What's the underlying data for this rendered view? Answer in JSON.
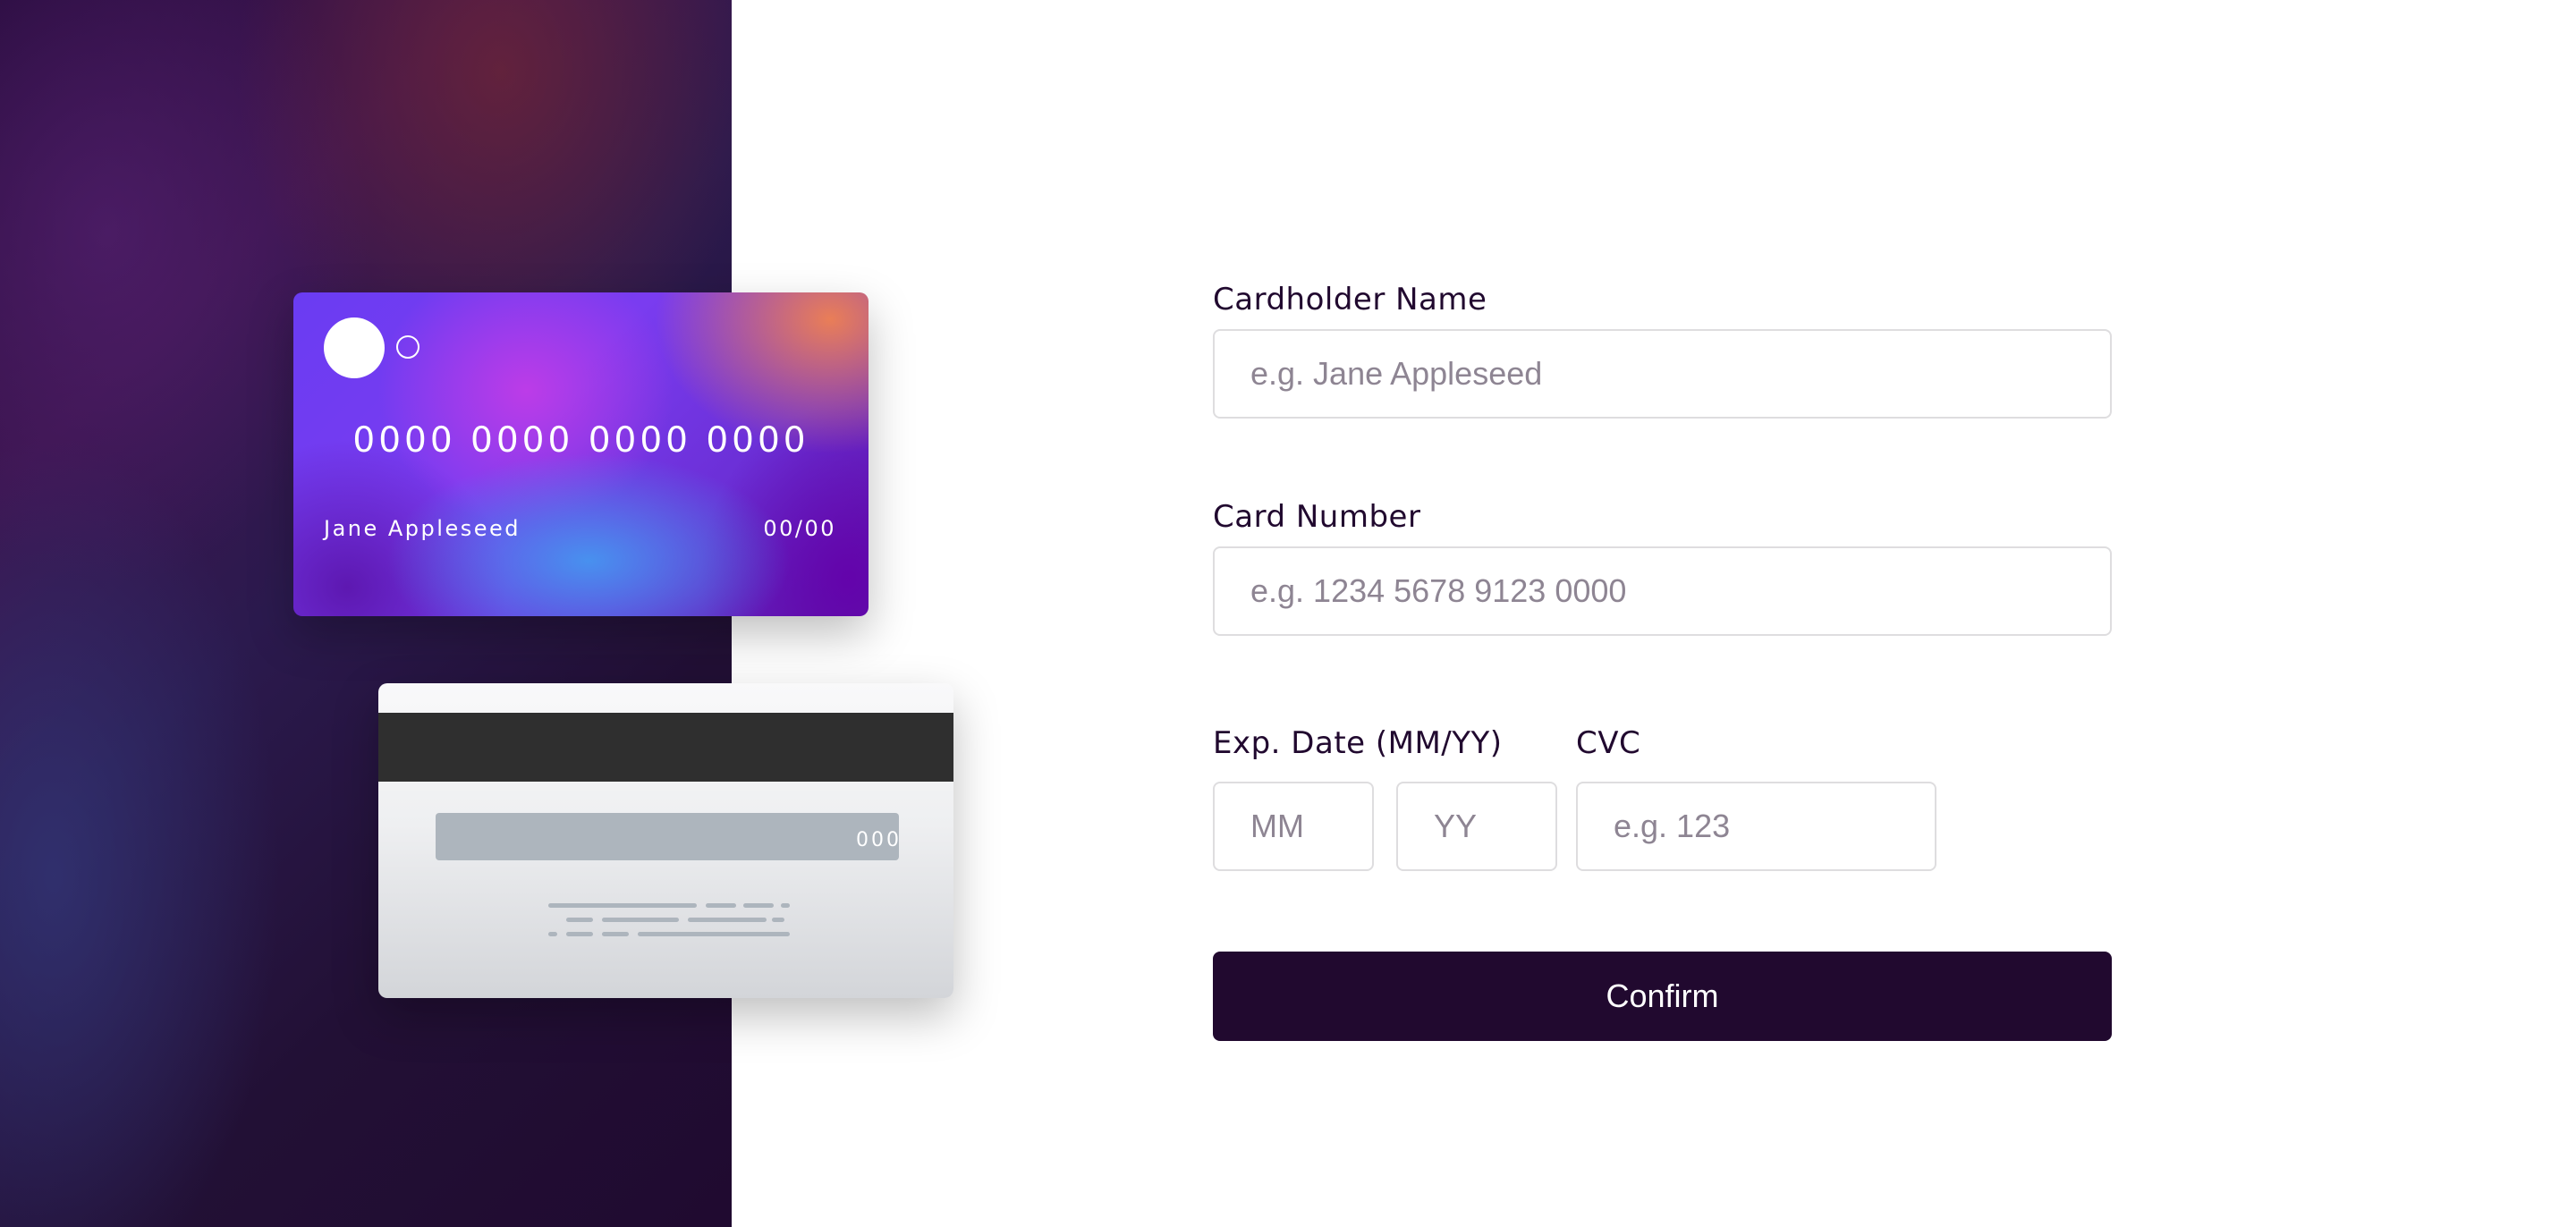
{
  "card_front": {
    "number": "0000 0000 0000 0000",
    "name": "Jane Appleseed",
    "expiry": "00/00"
  },
  "card_back": {
    "cvc": "000"
  },
  "form": {
    "name_label": "Cardholder Name",
    "name_placeholder": "e.g. Jane Appleseed",
    "number_label": "Card Number",
    "number_placeholder": "e.g. 1234 5678 9123 0000",
    "expiry_label": "Exp. Date (MM/YY)",
    "month_placeholder": "MM",
    "year_placeholder": "YY",
    "cvc_label": "CVC",
    "cvc_placeholder": "e.g. 123",
    "confirm_label": "Confirm"
  },
  "colors": {
    "dark_violet": "#21092f",
    "input_border": "#dedddf",
    "placeholder_gray": "#8e8593",
    "signature_gray": "#adb5bd",
    "stripe_dark": "#2f2f2f"
  }
}
